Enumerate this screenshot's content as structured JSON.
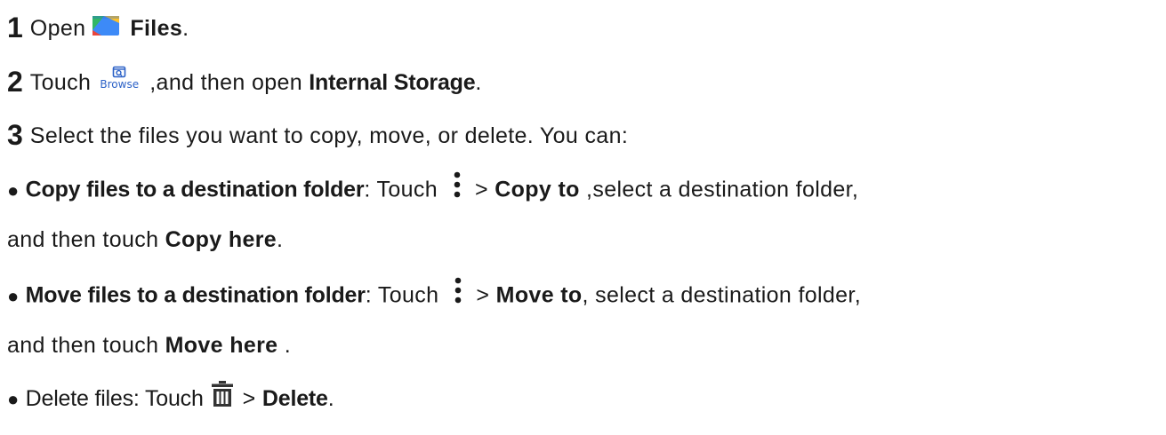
{
  "steps": [
    {
      "number": "1",
      "open": "Open",
      "app": "Files",
      "end": "."
    },
    {
      "number": "2",
      "touch": "Touch",
      "browse_label": "Browse",
      "then_open": ",and then open ",
      "storage": "Internal Storage",
      "end": "."
    },
    {
      "number": "3",
      "text": "Select the files you want to copy, move, or delete. You can:"
    }
  ],
  "options": {
    "copy": {
      "bullet": "●",
      "title": "Copy files to a destination folder",
      "touch": ": Touch",
      "gt": ">",
      "action": "Copy to",
      "rest": ",select a destination folder,",
      "cont": "and then touch ",
      "confirm": "Copy here",
      "end": "."
    },
    "move": {
      "bullet": "●",
      "title": "Move files to a destination folder",
      "touch": ": Touch",
      "gt": "> ",
      "action": "Move to",
      "rest": ", select a destination folder,",
      "cont": "and then touch ",
      "confirm": "Move here",
      "end": " ."
    },
    "delete": {
      "bullet": "●",
      "label": "Delete files: Touch",
      "gt": "> ",
      "action": "Delete",
      "end": "."
    }
  },
  "icons": {
    "files": "files-app-icon",
    "browse": "browse-icon",
    "more": "kebab-menu-icon",
    "trash": "trash-icon"
  },
  "colors": {
    "text": "#1a1a1a",
    "icon_gray": "#333333",
    "browse_blue": "#2b61c7",
    "files_blue": "#3d8af7",
    "files_green": "#32b665",
    "files_yellow": "#fbc02d",
    "files_red": "#e8453c"
  }
}
